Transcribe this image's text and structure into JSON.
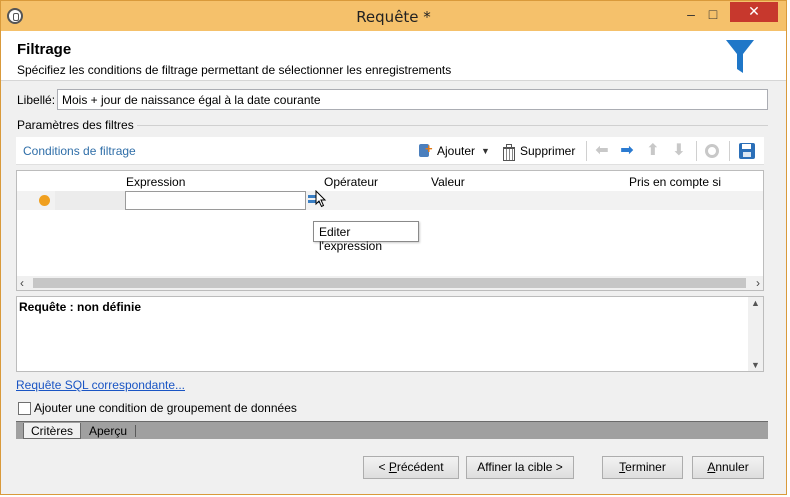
{
  "window": {
    "title": "Requête *",
    "min_glyph": "–",
    "max_glyph": "□",
    "close_glyph": "✕"
  },
  "header": {
    "title": "Filtrage",
    "subtitle": "Spécifiez les conditions de filtrage permettant de sélectionner les enregistrements"
  },
  "label_field": {
    "label": "Libellé:",
    "value": "Mois + jour de naissance égal à la date courante"
  },
  "filters_section": {
    "label": "Paramètres des filtres"
  },
  "toolbar": {
    "tab_label": "Conditions de filtrage",
    "add_label": "Ajouter",
    "delete_label": "Supprimer"
  },
  "grid": {
    "columns": [
      "Expression",
      "Opérateur",
      "Valeur",
      "Pris en compte si"
    ],
    "rows": [
      {
        "expression": "",
        "operator": "",
        "value": "",
        "condition": ""
      }
    ],
    "tooltip": "Editer l'expression"
  },
  "query": {
    "text": "Requête : non définie"
  },
  "sql_link": "Requête SQL correspondante...",
  "group_checkbox": {
    "label": "Ajouter une condition de groupement de données",
    "checked": false
  },
  "bottom_tabs": {
    "criteria": "Critères",
    "preview": "Aperçu"
  },
  "buttons": {
    "prev": {
      "prefix": "< ",
      "mnemonic": "P",
      "rest": "récédent"
    },
    "next": "Affiner la cible >",
    "finish": {
      "mnemonic": "T",
      "rest": "erminer"
    },
    "cancel": {
      "mnemonic": "A",
      "rest": "nnuler"
    }
  },
  "colors": {
    "titlebar": "#f5c16b",
    "accent_blue": "#2b7bd1",
    "funnel": "#1f77c8",
    "status_dot": "#f0a020",
    "close": "#c7382d"
  }
}
